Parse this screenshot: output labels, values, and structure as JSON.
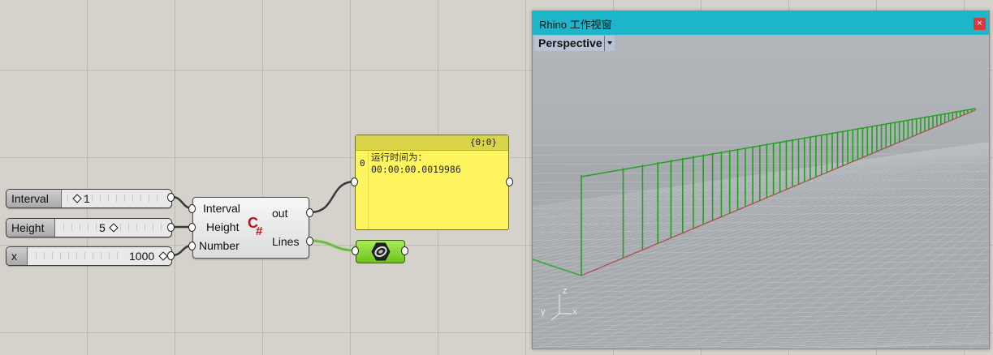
{
  "sliders": [
    {
      "label": "Interval",
      "value": "1",
      "grip": "◇"
    },
    {
      "label": "Height",
      "value": "5",
      "grip": "◇"
    },
    {
      "label": "x",
      "value": "1000",
      "grip": "◇"
    }
  ],
  "component": {
    "inputs": [
      "Interval",
      "Height",
      "Number"
    ],
    "outputs": [
      "out",
      "Lines"
    ],
    "icon": "csharp-script-icon",
    "icon_text": "C#"
  },
  "panel": {
    "path": "{0;0}",
    "index": "0",
    "lines": [
      "运行时间为：",
      "00:00:00.0019986"
    ]
  },
  "preview": {
    "icon": "custom-preview-icon"
  },
  "rhino": {
    "title": "Rhino 工作视窗",
    "close": "×",
    "viewport_name": "Perspective",
    "axes": {
      "z": "z",
      "y": "y",
      "x": "x"
    }
  },
  "colors": {
    "titlebar": "#1cb5c9",
    "panel": "#fff55f",
    "lines": "#22a022",
    "wire": "#3a3a3a",
    "wire_selected": "#8fd06a"
  }
}
